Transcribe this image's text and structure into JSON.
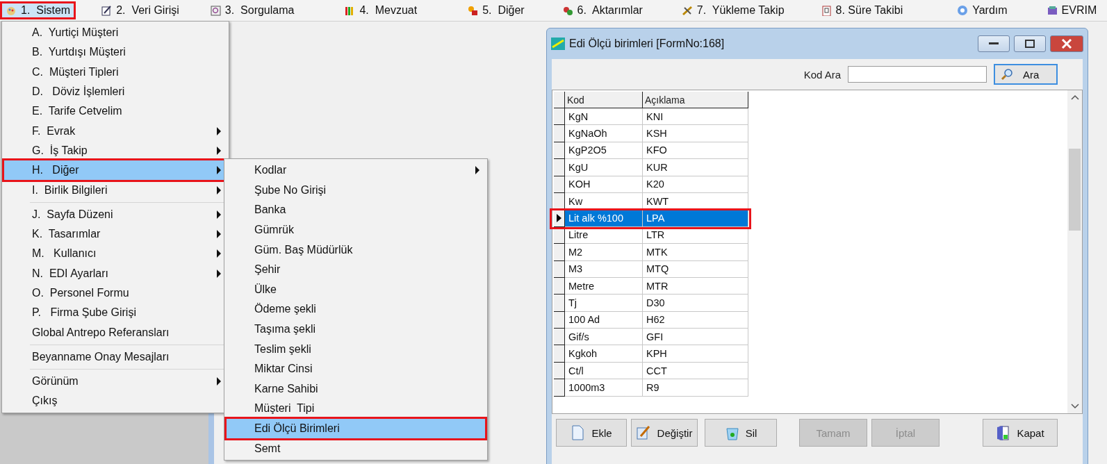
{
  "menubar": [
    {
      "label": "1.  Sistem",
      "selected": true,
      "highlighted": true
    },
    {
      "label": "2.  Veri Girişi",
      "selected": false,
      "highlighted": false
    },
    {
      "label": "3.  Sorgulama",
      "selected": false,
      "highlighted": false
    },
    {
      "label": "4.  Mevzuat",
      "selected": false,
      "highlighted": false
    },
    {
      "label": "5.  Diğer",
      "selected": false,
      "highlighted": false
    },
    {
      "label": "6.  Aktarımlar",
      "selected": false,
      "highlighted": false
    },
    {
      "label": "7.  Yükleme Takip",
      "selected": false,
      "highlighted": false
    },
    {
      "label": "8. Süre Takibi",
      "selected": false,
      "highlighted": false
    },
    {
      "label": "Yardım",
      "selected": false,
      "highlighted": false
    },
    {
      "label": "EVRIM",
      "selected": false,
      "highlighted": false
    }
  ],
  "system_menu": [
    {
      "kind": "item",
      "label": "A.  Yurtiçi Müşteri",
      "submenu": false,
      "selected": false,
      "highlighted": false
    },
    {
      "kind": "item",
      "label": "B.  Yurtdışı Müşteri",
      "submenu": false,
      "selected": false,
      "highlighted": false
    },
    {
      "kind": "item",
      "label": "C.  Müşteri Tipleri",
      "submenu": false,
      "selected": false,
      "highlighted": false
    },
    {
      "kind": "item",
      "label": "D.   Döviz İşlemleri",
      "submenu": false,
      "selected": false,
      "highlighted": false
    },
    {
      "kind": "item",
      "label": "E.  Tarife Cetvelim",
      "submenu": false,
      "selected": false,
      "highlighted": false
    },
    {
      "kind": "item",
      "label": "F.  Evrak",
      "submenu": true,
      "selected": false,
      "highlighted": false
    },
    {
      "kind": "item",
      "label": "G.  İş Takip",
      "submenu": true,
      "selected": false,
      "highlighted": false
    },
    {
      "kind": "item",
      "label": "H.   Diğer",
      "submenu": true,
      "selected": true,
      "highlighted": true
    },
    {
      "kind": "item",
      "label": "I.  Birlik Bilgileri",
      "submenu": true,
      "selected": false,
      "highlighted": false
    },
    {
      "kind": "separator"
    },
    {
      "kind": "item",
      "label": "J.  Sayfa Düzeni",
      "submenu": true,
      "selected": false,
      "highlighted": false
    },
    {
      "kind": "item",
      "label": "K.  Tasarımlar",
      "submenu": true,
      "selected": false,
      "highlighted": false
    },
    {
      "kind": "item",
      "label": "M.   Kullanıcı",
      "submenu": true,
      "selected": false,
      "highlighted": false
    },
    {
      "kind": "item",
      "label": "N.  EDI Ayarları",
      "submenu": true,
      "selected": false,
      "highlighted": false
    },
    {
      "kind": "item",
      "label": "O.  Personel Formu",
      "submenu": false,
      "selected": false,
      "highlighted": false
    },
    {
      "kind": "item",
      "label": "P.   Firma Şube Girişi",
      "submenu": false,
      "selected": false,
      "highlighted": false
    },
    {
      "kind": "item",
      "label": "Global Antrepo Referansları",
      "submenu": false,
      "selected": false,
      "highlighted": false
    },
    {
      "kind": "separator"
    },
    {
      "kind": "item",
      "label": "Beyanname Onay Mesajları",
      "submenu": false,
      "selected": false,
      "highlighted": false
    },
    {
      "kind": "separator"
    },
    {
      "kind": "item",
      "label": "Görünüm",
      "submenu": true,
      "selected": false,
      "highlighted": false
    },
    {
      "kind": "item",
      "label": "Çıkış",
      "submenu": false,
      "selected": false,
      "highlighted": false
    }
  ],
  "other_submenu": [
    {
      "kind": "item",
      "label": "Kodlar",
      "submenu": true,
      "selected": false,
      "highlighted": false
    },
    {
      "kind": "item",
      "label": "Şube No Girişi",
      "submenu": false,
      "selected": false,
      "highlighted": false
    },
    {
      "kind": "item",
      "label": "Banka",
      "submenu": false,
      "selected": false,
      "highlighted": false
    },
    {
      "kind": "item",
      "label": "Gümrük",
      "submenu": false,
      "selected": false,
      "highlighted": false
    },
    {
      "kind": "item",
      "label": "Güm. Baş Müdürlük",
      "submenu": false,
      "selected": false,
      "highlighted": false
    },
    {
      "kind": "item",
      "label": "Şehir",
      "submenu": false,
      "selected": false,
      "highlighted": false
    },
    {
      "kind": "item",
      "label": "Ülke",
      "submenu": false,
      "selected": false,
      "highlighted": false
    },
    {
      "kind": "item",
      "label": "Ödeme şekli",
      "submenu": false,
      "selected": false,
      "highlighted": false
    },
    {
      "kind": "item",
      "label": "Taşıma şekli",
      "submenu": false,
      "selected": false,
      "highlighted": false
    },
    {
      "kind": "item",
      "label": "Teslim şekli",
      "submenu": false,
      "selected": false,
      "highlighted": false
    },
    {
      "kind": "item",
      "label": "Miktar Cinsi",
      "submenu": false,
      "selected": false,
      "highlighted": false
    },
    {
      "kind": "item",
      "label": "Karne Sahibi",
      "submenu": false,
      "selected": false,
      "highlighted": false
    },
    {
      "kind": "item",
      "label": "Müşteri  Tipi",
      "submenu": false,
      "selected": false,
      "highlighted": false
    },
    {
      "kind": "item",
      "label": "Edi Ölçü Birimleri",
      "submenu": false,
      "selected": true,
      "highlighted": true
    },
    {
      "kind": "item",
      "label": "Semt",
      "submenu": false,
      "selected": false,
      "highlighted": false
    }
  ],
  "window": {
    "title": "Edi Ölçü birimleri [FormNo:168]",
    "search": {
      "label": "Kod Ara",
      "button": "Ara"
    },
    "table": {
      "columns": [
        "Kod",
        "Açıklama"
      ],
      "rows": [
        {
          "cells": [
            "KgN",
            "KNI"
          ],
          "selected": false,
          "highlighted": false
        },
        {
          "cells": [
            "KgNaOh",
            "KSH"
          ],
          "selected": false,
          "highlighted": false
        },
        {
          "cells": [
            "KgP2O5",
            "KFO"
          ],
          "selected": false,
          "highlighted": false
        },
        {
          "cells": [
            "KgU",
            "KUR"
          ],
          "selected": false,
          "highlighted": false
        },
        {
          "cells": [
            "KOH",
            "K20"
          ],
          "selected": false,
          "highlighted": false
        },
        {
          "cells": [
            "Kw",
            "KWT"
          ],
          "selected": false,
          "highlighted": false
        },
        {
          "cells": [
            "Lit alk %100",
            "LPA"
          ],
          "selected": true,
          "highlighted": true
        },
        {
          "cells": [
            "Litre",
            "LTR"
          ],
          "selected": false,
          "highlighted": false
        },
        {
          "cells": [
            "M2",
            "MTK"
          ],
          "selected": false,
          "highlighted": false
        },
        {
          "cells": [
            "M3",
            "MTQ"
          ],
          "selected": false,
          "highlighted": false
        },
        {
          "cells": [
            "Metre",
            "MTR"
          ],
          "selected": false,
          "highlighted": false
        },
        {
          "cells": [
            "Tj",
            "D30"
          ],
          "selected": false,
          "highlighted": false
        },
        {
          "cells": [
            "100 Ad",
            "H62"
          ],
          "selected": false,
          "highlighted": false
        },
        {
          "cells": [
            "Gif/s",
            "GFI"
          ],
          "selected": false,
          "highlighted": false
        },
        {
          "cells": [
            "Kgkoh",
            "KPH"
          ],
          "selected": false,
          "highlighted": false
        },
        {
          "cells": [
            "Ct/l",
            "CCT"
          ],
          "selected": false,
          "highlighted": false
        },
        {
          "cells": [
            "1000m3",
            "R9"
          ],
          "selected": false,
          "highlighted": false
        }
      ]
    },
    "buttons": [
      {
        "label": "Ekle",
        "disabled": false
      },
      {
        "label": "Değiştir",
        "disabled": false
      },
      {
        "label": "Sil",
        "disabled": false
      },
      {
        "label": "Tamam",
        "disabled": true
      },
      {
        "label": "İptal",
        "disabled": true
      },
      {
        "label": "Kapat",
        "disabled": false
      }
    ]
  }
}
